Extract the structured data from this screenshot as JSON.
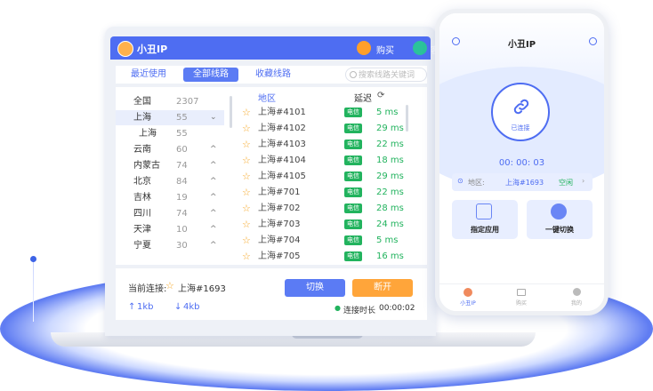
{
  "app": {
    "title": "小丑IP"
  },
  "titlebar": {
    "buy": "购买",
    "service": "客"
  },
  "tabs": [
    {
      "label": "最近使用"
    },
    {
      "label": "全部线路"
    },
    {
      "label": "收藏线路"
    }
  ],
  "search": {
    "placeholder": "搜索线路关键词"
  },
  "regions": [
    {
      "name": "全国",
      "count": "2307",
      "arrow": ""
    },
    {
      "name": "上海",
      "count": "55",
      "arrow": "⌄"
    },
    {
      "name": "上海",
      "count": "55",
      "arrow": ""
    },
    {
      "name": "云南",
      "count": "60",
      "arrow": "^"
    },
    {
      "name": "内蒙古",
      "count": "74",
      "arrow": "^"
    },
    {
      "name": "北京",
      "count": "84",
      "arrow": "^"
    },
    {
      "name": "吉林",
      "count": "19",
      "arrow": "^"
    },
    {
      "name": "四川",
      "count": "74",
      "arrow": "^"
    },
    {
      "name": "天津",
      "count": "10",
      "arrow": "^"
    },
    {
      "name": "宁夏",
      "count": "30",
      "arrow": "^"
    }
  ],
  "lines_header": {
    "region": "地区",
    "latency": "延迟"
  },
  "lines": [
    {
      "name": "上海#4101",
      "isp": "电信",
      "latency": "5 ms"
    },
    {
      "name": "上海#4102",
      "isp": "电信",
      "latency": "29 ms"
    },
    {
      "name": "上海#4103",
      "isp": "电信",
      "latency": "22 ms"
    },
    {
      "name": "上海#4104",
      "isp": "电信",
      "latency": "18 ms"
    },
    {
      "name": "上海#4105",
      "isp": "电信",
      "latency": "29 ms"
    },
    {
      "name": "上海#701",
      "isp": "电信",
      "latency": "22 ms"
    },
    {
      "name": "上海#702",
      "isp": "电信",
      "latency": "28 ms"
    },
    {
      "name": "上海#703",
      "isp": "电信",
      "latency": "24 ms"
    },
    {
      "name": "上海#704",
      "isp": "电信",
      "latency": "5 ms"
    },
    {
      "name": "上海#705",
      "isp": "电信",
      "latency": "16 ms"
    }
  ],
  "connection": {
    "current_label": "当前连接:",
    "current_line": "上海#1693",
    "upload": "1kb",
    "download": "4kb",
    "switch_label": "切换",
    "disconnect_label": "断开",
    "duration_label": "连接时长",
    "duration": "00:00:02"
  },
  "phone": {
    "title": "小丑IP",
    "status": "已连接",
    "time": "00: 00: 03",
    "region_label": "地区:",
    "region_value": "上海#1693",
    "region_state": "空闲",
    "card_app": "指定应用",
    "card_switch": "一键切换",
    "nav": [
      {
        "label": "小丑IP"
      },
      {
        "label": "购买"
      },
      {
        "label": "我的"
      }
    ]
  },
  "colors": {
    "accent": "#4e6df2",
    "orange": "#ffa53a",
    "green": "#22b35e"
  }
}
